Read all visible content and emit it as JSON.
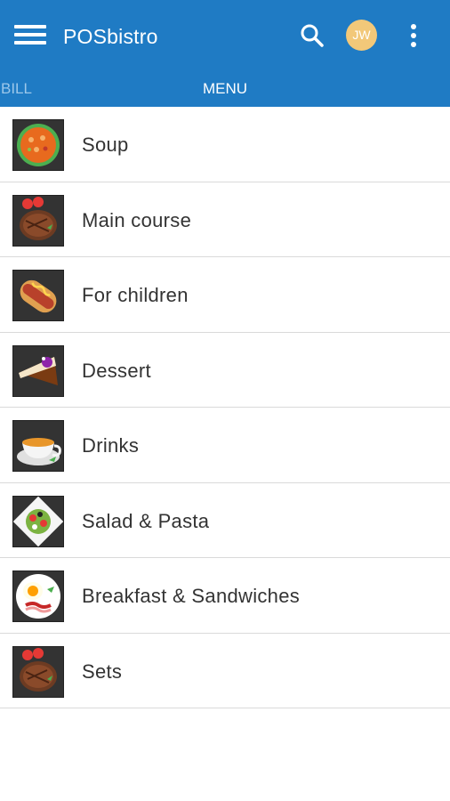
{
  "appbar": {
    "title": "POSbistro",
    "avatar_initials": "JW",
    "background_color": "#1f7bc4",
    "avatar_color": "#f2c879",
    "icons": {
      "menu": "hamburger-menu-icon",
      "search": "search-icon",
      "more": "more-vert-icon"
    }
  },
  "tabs": [
    {
      "label": "BILL",
      "active": false
    },
    {
      "label": "MENU",
      "active": true
    }
  ],
  "categories": [
    {
      "label": "Soup",
      "icon": "soup-icon"
    },
    {
      "label": "Main course",
      "icon": "steak-icon"
    },
    {
      "label": "For children",
      "icon": "hotdog-icon"
    },
    {
      "label": "Dessert",
      "icon": "cake-slice-icon"
    },
    {
      "label": "Drinks",
      "icon": "tea-cup-icon"
    },
    {
      "label": "Salad & Pasta",
      "icon": "salad-icon"
    },
    {
      "label": "Breakfast & Sandwiches",
      "icon": "fried-egg-icon"
    },
    {
      "label": "Sets",
      "icon": "steak-icon"
    }
  ]
}
